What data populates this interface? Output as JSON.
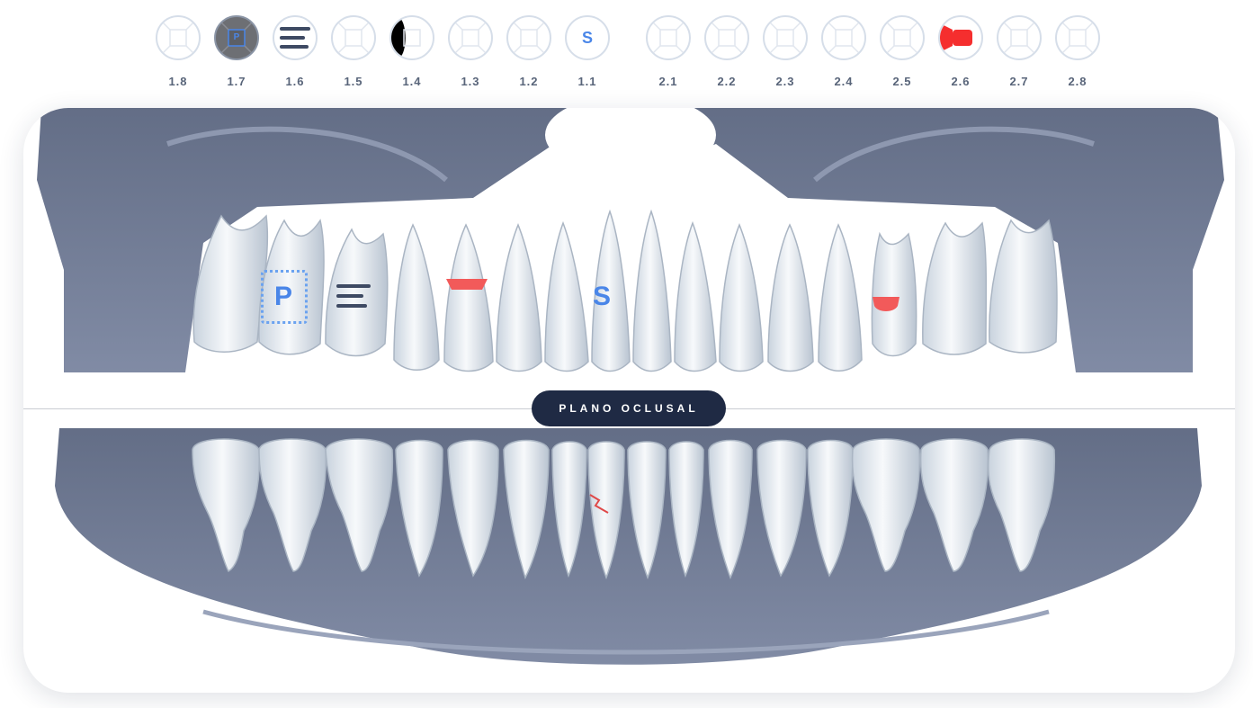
{
  "upper_selector": [
    {
      "number": "1.8",
      "state": "empty"
    },
    {
      "number": "1.7",
      "state": "selected",
      "letter": "P"
    },
    {
      "number": "1.6",
      "state": "lines"
    },
    {
      "number": "1.5",
      "state": "empty"
    },
    {
      "number": "1.4",
      "state": "half-black"
    },
    {
      "number": "1.3",
      "state": "empty"
    },
    {
      "number": "1.2",
      "state": "empty"
    },
    {
      "number": "1.1",
      "state": "letter",
      "letter": "S"
    },
    {
      "number": "2.1",
      "state": "empty"
    },
    {
      "number": "2.2",
      "state": "empty"
    },
    {
      "number": "2.3",
      "state": "empty"
    },
    {
      "number": "2.4",
      "state": "empty"
    },
    {
      "number": "2.5",
      "state": "empty"
    },
    {
      "number": "2.6",
      "state": "red-filling"
    },
    {
      "number": "2.7",
      "state": "empty"
    },
    {
      "number": "2.8",
      "state": "empty"
    }
  ],
  "chart_marks": {
    "tooth_1_7_letter": "P",
    "tooth_1_1_letter": "S"
  },
  "occlusal_plane_label": "PLANO OCLUSAL",
  "colors": {
    "accent_blue": "#4a86e8",
    "marker_red": "#f25a5a",
    "navy": "#1f2a44",
    "bone": "#6f7a93",
    "tooth": "#eef2f6"
  }
}
